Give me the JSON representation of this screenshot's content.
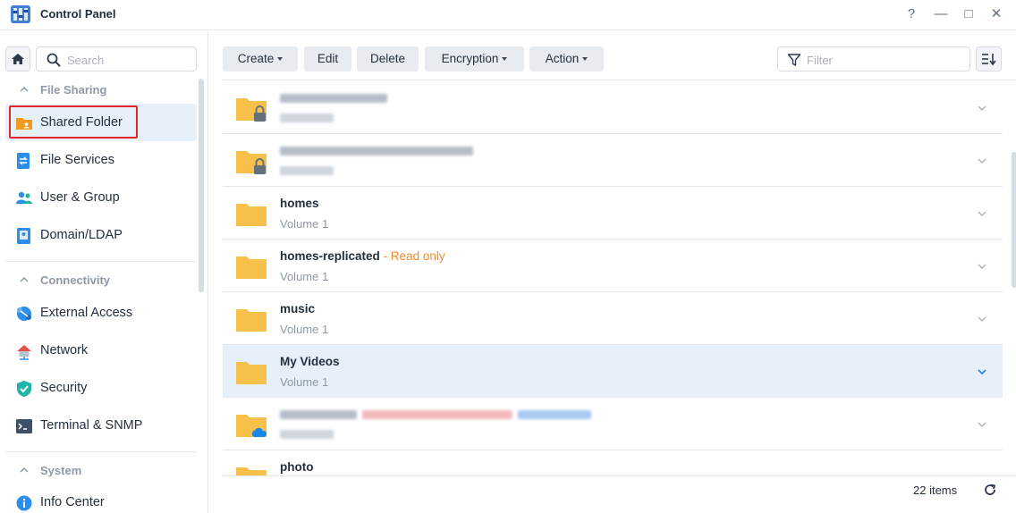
{
  "window": {
    "title": "Control Panel",
    "buttons": [
      "?",
      "—",
      "□",
      "✕"
    ]
  },
  "sidebar": {
    "search_placeholder": "Search",
    "sections": [
      {
        "label": "File Sharing"
      },
      {
        "label": "Connectivity"
      },
      {
        "label": "System"
      }
    ],
    "items": [
      {
        "label": "Shared Folder",
        "icon": "shared-folder-icon",
        "selected": true
      },
      {
        "label": "File Services",
        "icon": "file-services-icon"
      },
      {
        "label": "User & Group",
        "icon": "user-group-icon"
      },
      {
        "label": "Domain/LDAP",
        "icon": "domain-ldap-icon"
      },
      {
        "label": "External Access",
        "icon": "external-access-icon"
      },
      {
        "label": "Network",
        "icon": "network-icon"
      },
      {
        "label": "Security",
        "icon": "security-shield-icon"
      },
      {
        "label": "Terminal & SNMP",
        "icon": "terminal-icon"
      },
      {
        "label": "Info Center",
        "icon": "info-icon"
      }
    ]
  },
  "toolbar": {
    "create": "Create",
    "edit": "Edit",
    "delete": "Delete",
    "encryption": "Encryption",
    "action": "Action",
    "filter_placeholder": "Filter"
  },
  "folders": [
    {
      "name": "",
      "sub": "",
      "blurred": true,
      "badge": "lock"
    },
    {
      "name": "",
      "sub": "",
      "blurred": true,
      "badge": "lock"
    },
    {
      "name": "homes",
      "sub": "Volume 1"
    },
    {
      "name": "homes-replicated",
      "extra": "- Read only",
      "sub": "Volume 1"
    },
    {
      "name": "music",
      "sub": "Volume 1"
    },
    {
      "name": "My Videos",
      "sub": "Volume 1",
      "selected": true
    },
    {
      "name": "",
      "sub": "",
      "blurred": true,
      "badge": "cloud"
    },
    {
      "name": "photo",
      "sub": ""
    }
  ],
  "footer": {
    "count": "22 items"
  },
  "colors": {
    "accent": "#1a87e6",
    "selected_bg": "#e5f0fb",
    "folder": "#f7c04a",
    "warning_text": "#f28b2a",
    "highlight": "#e0242a"
  }
}
